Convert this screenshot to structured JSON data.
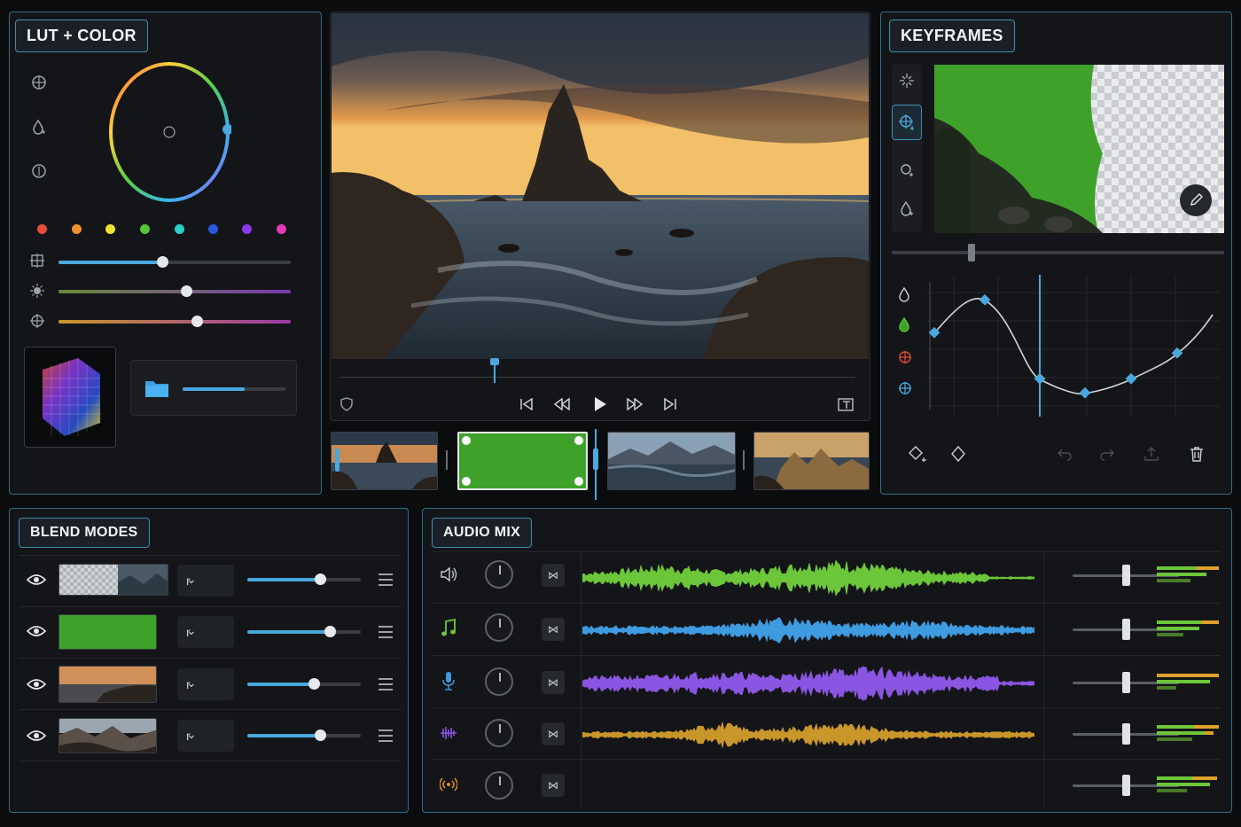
{
  "lut_panel": {
    "title": "LUT + COLOR",
    "swatches": [
      "#e84a3c",
      "#f0902a",
      "#f2e230",
      "#56c437",
      "#2bd0c8",
      "#2a56e0",
      "#8a3ae6",
      "#e23ab8"
    ],
    "sliders": [
      0.45,
      0.55,
      0.6
    ],
    "folder_progress": 0.6
  },
  "preview": {
    "playhead": 0.3
  },
  "keyframes_panel": {
    "title": "KEYFRAMES",
    "scrub": 0.25
  },
  "blend_panel": {
    "title": "BLEND MODES",
    "rows": [
      {
        "mode": "r",
        "opacity": 0.64
      },
      {
        "mode": "r",
        "opacity": 0.73
      },
      {
        "mode": "r",
        "opacity": 0.59
      },
      {
        "mode": "r",
        "opacity": 0.64
      }
    ]
  },
  "audio_panel": {
    "title": "AUDIO MIX",
    "tracks": [
      {
        "icon": "speaker-icon",
        "color": "#6cc63a",
        "fader": 0.5
      },
      {
        "icon": "music-note-icon",
        "color": "#3f9be0",
        "fader": 0.5
      },
      {
        "icon": "microphone-icon",
        "color": "#8a55e0",
        "fader": 0.5
      },
      {
        "icon": "sound-effect-icon",
        "color": "#c9962a",
        "fader": 0.5
      },
      {
        "icon": "broadcast-icon",
        "color": "#e0902a",
        "fader": 0.5
      }
    ]
  }
}
